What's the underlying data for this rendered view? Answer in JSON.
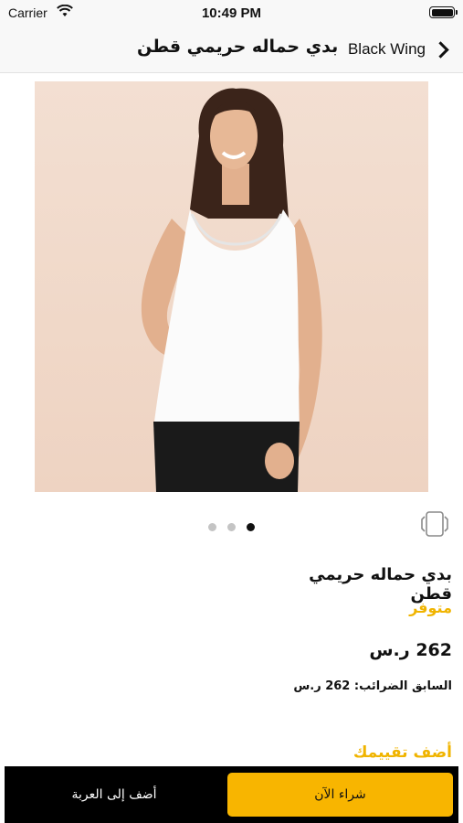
{
  "status_bar": {
    "carrier": "Carrier",
    "time": "10:49 PM"
  },
  "nav": {
    "title": "بدي حماله حريمي قطن",
    "back_label": "Black Wing"
  },
  "gallery": {
    "page_count": 3,
    "active_page": 3
  },
  "product": {
    "name": "بدي حماله حريمي قطن",
    "availability": "متوفر",
    "price": "262 ر.س",
    "previous_price": "السابق الضرائب: 262 ر.س",
    "add_rating": "أضف تقييمك"
  },
  "actions": {
    "add_to_cart": "أضف إلى العربة",
    "buy_now": "شراء الآن"
  },
  "colors": {
    "accent": "#f8b500",
    "availability": "#f0b400",
    "bottom_bar": "#000000"
  },
  "icons": [
    "wifi-icon",
    "battery-icon",
    "chevron-right-icon",
    "ar-view-icon"
  ]
}
